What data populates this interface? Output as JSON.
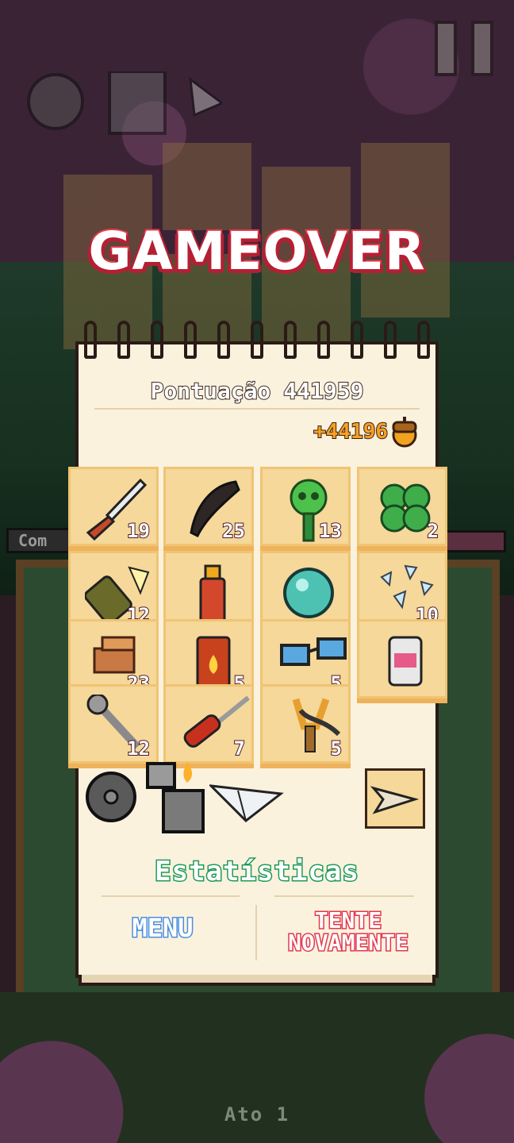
{
  "title": "GAMEOVER",
  "score": {
    "label": "Pontuação",
    "value": "441959"
  },
  "bonus": {
    "value": "+44196",
    "icon": "acorn-icon"
  },
  "items": [
    {
      "icon": "kitchen-knife-icon",
      "count": "19"
    },
    {
      "icon": "black-feather-icon",
      "count": "25"
    },
    {
      "icon": "toxic-skull-flask-icon",
      "count": "13"
    },
    {
      "icon": "four-leaf-clover-icon",
      "count": "2"
    },
    {
      "icon": "broken-bottle-icon",
      "count": "12"
    },
    {
      "icon": "spray-can-icon",
      "count": ""
    },
    {
      "icon": "crystal-orb-icon",
      "count": ""
    },
    {
      "icon": "glass-shards-icon",
      "count": "10"
    },
    {
      "icon": "wood-block-icon",
      "count": "23"
    },
    {
      "icon": "fire-jar-icon",
      "count": "5"
    },
    {
      "icon": "sunglasses-icon",
      "count": "5"
    },
    {
      "icon": "paint-can-icon",
      "count": ""
    },
    {
      "icon": "wrench-icon",
      "count": "12"
    },
    {
      "icon": "screwdriver-icon",
      "count": "7"
    },
    {
      "icon": "slingshot-icon",
      "count": "5"
    }
  ],
  "relics": [
    "wheel-icon",
    "lighter-icon",
    "paper-plane-icon"
  ],
  "weapon": "arrowhead-icon",
  "stats_label": "Estatísticas",
  "menu_label": "MENU",
  "retry_label_1": "TENTE",
  "retry_label_2": "NOVAMENTE",
  "background": {
    "act_label": "Ato 1",
    "side_label": "Com"
  }
}
